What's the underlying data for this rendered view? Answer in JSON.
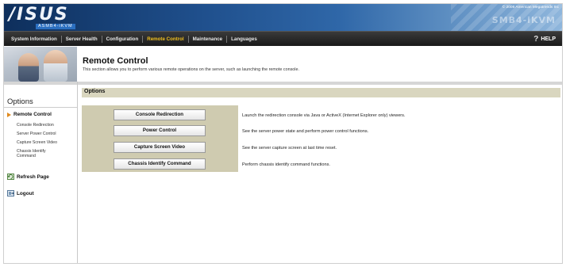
{
  "header": {
    "logo_text": "/ISUS",
    "logo_sub": "ASMB4-iKVM",
    "copyright": "© 2006 American Megatrends Inc",
    "brand_watermark": "SMB4-iKVM"
  },
  "nav": {
    "items": [
      {
        "label": "System Information"
      },
      {
        "label": "Server Health"
      },
      {
        "label": "Configuration"
      },
      {
        "label": "Remote Control",
        "active": true
      },
      {
        "label": "Maintenance"
      },
      {
        "label": "Languages"
      }
    ],
    "help_icon": "?",
    "help_label": "HELP"
  },
  "page": {
    "title": "Remote Control",
    "description": "This section allows you to perform various remote operations on the server, such as launching the remote console."
  },
  "sidebar": {
    "heading": "Options",
    "main_item": "Remote Control",
    "sub_items": [
      "Console Redirection",
      "Server Power Control",
      "Capture Screen Video",
      "Chassis Identify Command"
    ],
    "refresh_label": "Refresh Page",
    "logout_label": "Logout"
  },
  "content": {
    "section_title": "Options",
    "buttons": [
      {
        "label": "Console Redirection",
        "description": "Launch the redirection console via Java or ActiveX (Internet Explorer only) viewers."
      },
      {
        "label": "Power Control",
        "description": "See the server power state and perform power control functions."
      },
      {
        "label": "Capture Screen Video",
        "description": "See the server capture screen at last time reset."
      },
      {
        "label": "Chassis Identify Command",
        "description": "Perform chassis identify command functions."
      }
    ]
  },
  "colors": {
    "nav_active": "#f0c020",
    "options_bar": "#d9d6bf",
    "button_panel": "#cfcbb0",
    "arrow": "#e08a1e"
  }
}
